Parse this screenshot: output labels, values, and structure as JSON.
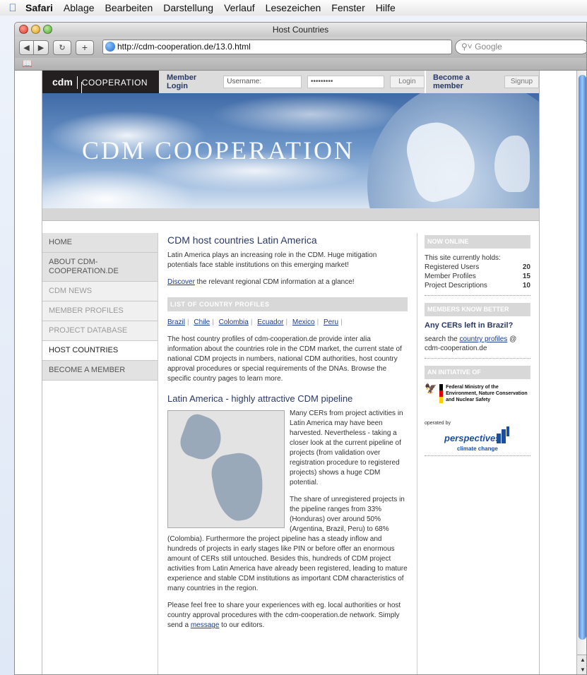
{
  "menubar": {
    "app": "Safari",
    "items": [
      "Ablage",
      "Bearbeiten",
      "Darstellung",
      "Verlauf",
      "Lesezeichen",
      "Fenster",
      "Hilfe"
    ]
  },
  "window": {
    "title": "Host Countries",
    "url": "http://cdm-cooperation.de/13.0.html",
    "search_placeholder": "Google"
  },
  "site": {
    "logo_bold": "cdm",
    "logo_text": "COOPERATION",
    "login": {
      "label": "Member Login",
      "username": "Username:",
      "password": "•••••••••",
      "button": "Login"
    },
    "member": {
      "label": "Become a member",
      "button": "Signup"
    },
    "banner_title": "CDM COOPERATION"
  },
  "nav": [
    {
      "label": "HOME"
    },
    {
      "label": "ABOUT CDM-COOPERATION.DE"
    },
    {
      "label": "CDM NEWS"
    },
    {
      "label": "MEMBER PROFILES"
    },
    {
      "label": "PROJECT DATABASE"
    },
    {
      "label": "HOST COUNTRIES"
    },
    {
      "label": "BECOME A MEMBER"
    }
  ],
  "main": {
    "title": "CDM host countries Latin America",
    "intro": "Latin America plays an increasing role in the CDM. Huge mitigation potentials face stable institutions on this emerging market!",
    "discover_link": "Discover",
    "discover_rest": " the relevant regional CDM information at a glance!",
    "list_head": "LIST OF COUNTRY PROFILES",
    "countries": [
      "Brazil",
      "Chile",
      "Colombia",
      "Ecuador",
      "Mexico",
      "Peru"
    ],
    "profiles_text": "The host country profiles of cdm-cooperation.de provide inter alia information about the countries role in the CDM market, the current state of national CDM projects in numbers, national CDM authorities, host country approval procedures or special requirements of the DNAs. Browse the specific country pages to learn more.",
    "pipeline_title": "Latin America - highly attractive CDM pipeline",
    "pipeline_p1": "Many CERs from project activities in Latin America may have been harvested. Nevertheless - taking a closer look at the current pipeline of projects (from validation over registration procedure to registered projects) shows a huge CDM potential.",
    "pipeline_p2": "The share of unregistered projects in the pipeline ranges from 33% (Honduras) over around 50% (Argentina, Brazil, Peru) to 68% (Colombia). Furthermore the project pipeline has a steady inflow and hundreds of projects in early stages like PIN or before offer an enormous amount of CERs still untouched. Besides this, hundreds of CDM project activities from Latin America have already been registered, leading to mature experience and stable CDM institutions as important CDM characteristics of many countries in the region.",
    "share_text_a": "Please feel free to share your experiences with eg. local authorities or host country approval procedures with the cdm-cooperation.de network. Simply send a ",
    "share_link": "message",
    "share_text_b": " to our editors."
  },
  "right": {
    "now_online_head": "NOW ONLINE",
    "holds_text": "This site currently holds:",
    "stats": [
      {
        "label": "Registered Users",
        "value": "20"
      },
      {
        "label": "Member Profiles",
        "value": "15"
      },
      {
        "label": "Project Descriptions",
        "value": "10"
      }
    ],
    "know_head": "MEMBERS KNOW BETTER",
    "know_title": "Any CERs left in Brazil?",
    "know_text_a": "search the ",
    "know_link": "country profiles",
    "know_text_b": " @ cdm-cooperation.de",
    "initiative_head": "AN INITIATIVE OF",
    "ministry": "Federal Ministry of the Environment, Nature Conservation and Nuclear Safety",
    "operated_by": "operated by",
    "partner_name": "perspectives",
    "partner_sub": "climate change"
  },
  "colors": {
    "accent_blue": "#2a3a66",
    "link_blue": "#1a3d8f"
  }
}
